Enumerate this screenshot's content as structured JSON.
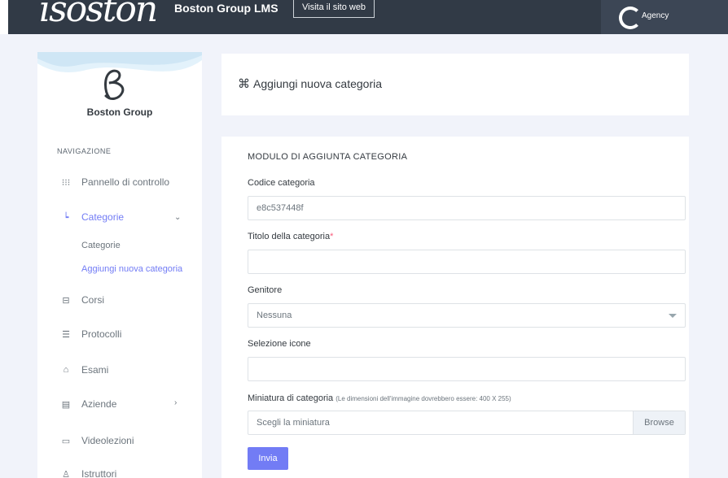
{
  "topbar": {
    "logo_text": "isoston",
    "brand_title": "Boston Group LMS",
    "visit_label": "Visita il sito web",
    "user_sub": "Agency"
  },
  "sidebar": {
    "brand": "Boston Group",
    "nav_title": "NAVIGAZIONE",
    "items": [
      {
        "label": "Pannello di controllo",
        "icon": "grid-dots-icon"
      },
      {
        "label": "Categorie",
        "icon": "tree-icon"
      },
      {
        "label": "Corsi",
        "icon": "archive-icon"
      },
      {
        "label": "Protocolli",
        "icon": "list-icon"
      },
      {
        "label": "Esami",
        "icon": "graduation-icon"
      },
      {
        "label": "Aziende",
        "icon": "building-icon"
      },
      {
        "label": "Videolezioni",
        "icon": "video-icon"
      },
      {
        "label": "Istruttori",
        "icon": "user-icon"
      }
    ],
    "sub_items": [
      {
        "label": "Categorie"
      },
      {
        "label": "Aggiungi nuova categoria"
      }
    ]
  },
  "header": {
    "title": "Aggiungi nuova categoria"
  },
  "form": {
    "heading": "MODULO DI AGGIUNTA CATEGORIA",
    "code_label": "Codice categoria",
    "code_value": "e8c537448f",
    "title_label": "Titolo della categoria",
    "required_mark": "*",
    "title_value": "",
    "parent_label": "Genitore",
    "parent_value": "Nessuna",
    "icon_label": "Selezione icone",
    "icon_value": "",
    "thumb_label": "Miniatura di categoria",
    "thumb_hint": "(Le dimensioni dell'immagine dovrebbero essere: 400 X 255)",
    "thumb_placeholder": "Scegli la miniatura",
    "browse_label": "Browse",
    "submit_label": "Invia"
  },
  "colors": {
    "accent": "#727cf5",
    "topbar": "#313a46",
    "required": "#fa5c7c"
  }
}
